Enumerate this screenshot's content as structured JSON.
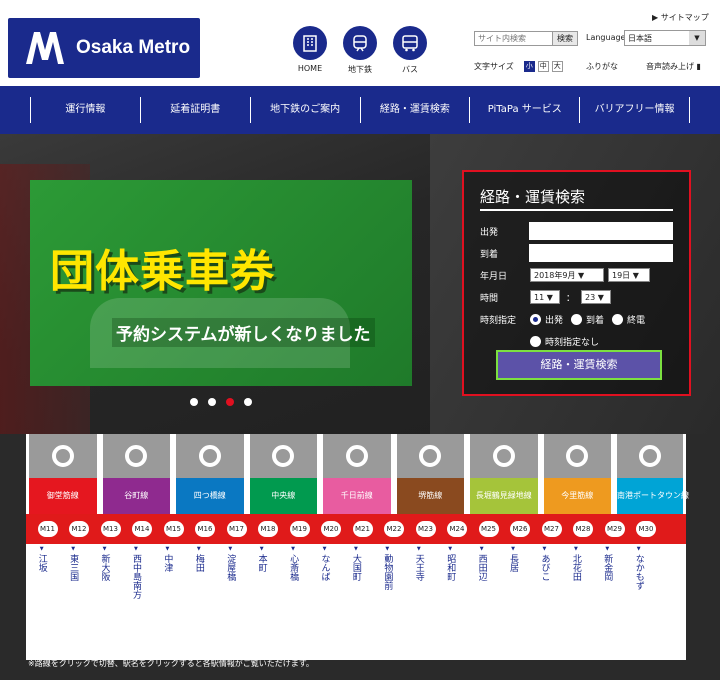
{
  "logo": {
    "text": "Osaka Metro"
  },
  "quicknav": [
    {
      "label": "HOME",
      "icon": "building-icon"
    },
    {
      "label": "地下鉄",
      "icon": "subway-icon"
    },
    {
      "label": "バス",
      "icon": "bus-icon"
    }
  ],
  "header": {
    "sitemap": "サイトマップ",
    "search_placeholder": "サイト内検索",
    "search_button": "検索",
    "language_label": "Language",
    "language_value": "日本語",
    "fontsize_label": "文字サイズ",
    "fontsize_options": [
      "小",
      "中",
      "大"
    ],
    "fontsize_active": "小",
    "furigana": "ふりがな",
    "onsei": "音声読み上げ"
  },
  "nav": [
    "運行情報",
    "延着証明書",
    "地下鉄のご案内",
    "経路・運賃検索",
    "PiTaPa サービス",
    "バリアフリー情報"
  ],
  "banner": {
    "title": "団体乗車券",
    "subtitle": "予約システムが新しくなりました",
    "slide_count": 4,
    "active_slide": 3
  },
  "route_search": {
    "title": "経路・運賃検索",
    "from_label": "出発",
    "to_label": "到着",
    "date_label": "年月日",
    "date_month": "2018年9月",
    "date_day": "19日",
    "time_label": "時間",
    "time_hour": "11",
    "time_sep": "：",
    "time_min": "23",
    "timespec_label": "時刻指定",
    "timespec_options": [
      "出発",
      "到着",
      "終電",
      "時刻指定なし"
    ],
    "timespec_selected": "出発",
    "button": "経路・運賃検索"
  },
  "lines": [
    {
      "name": "御堂筋線",
      "color": "#e5171f"
    },
    {
      "name": "谷町線",
      "color": "#8f2a8f"
    },
    {
      "name": "四つ橋線",
      "color": "#0a78c2"
    },
    {
      "name": "中央線",
      "color": "#019a4f"
    },
    {
      "name": "千日前線",
      "color": "#e85ca0"
    },
    {
      "name": "堺筋線",
      "color": "#8a4a1f"
    },
    {
      "name": "長堀鶴見緑地線",
      "color": "#a5c43a"
    },
    {
      "name": "今里筋線",
      "color": "#ee9a1f"
    },
    {
      "name": "南港ポートタウン線",
      "color": "#00a4d6"
    }
  ],
  "stations": [
    {
      "code": "M11",
      "name": "江坂"
    },
    {
      "code": "M12",
      "name": "東三国"
    },
    {
      "code": "M13",
      "name": "新大阪"
    },
    {
      "code": "M14",
      "name": "西中島南方"
    },
    {
      "code": "M15",
      "name": "中津"
    },
    {
      "code": "M16",
      "name": "梅田"
    },
    {
      "code": "M17",
      "name": "淀屋橋"
    },
    {
      "code": "M18",
      "name": "本町"
    },
    {
      "code": "M19",
      "name": "心斎橋"
    },
    {
      "code": "M20",
      "name": "なんば"
    },
    {
      "code": "M21",
      "name": "大国町"
    },
    {
      "code": "M22",
      "name": "動物園前"
    },
    {
      "code": "M23",
      "name": "天王寺"
    },
    {
      "code": "M24",
      "name": "昭和町"
    },
    {
      "code": "M25",
      "name": "西田辺"
    },
    {
      "code": "M26",
      "name": "長居"
    },
    {
      "code": "M27",
      "name": "あびこ"
    },
    {
      "code": "M28",
      "name": "北花田"
    },
    {
      "code": "M29",
      "name": "新金岡"
    },
    {
      "code": "M30",
      "name": "なかもず"
    }
  ],
  "footnote": "※路線をクリックで切替、駅名をクリックすると各駅情報がご覧いただけます。"
}
